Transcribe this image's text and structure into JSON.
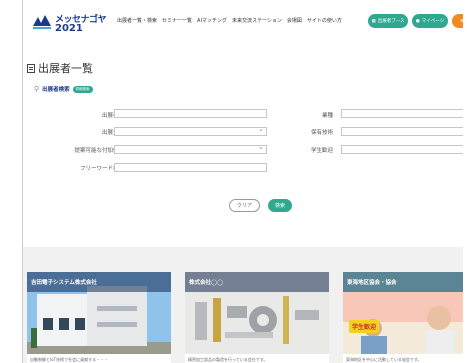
{
  "header": {
    "logo_name": "メッセナゴヤ",
    "logo_year": "2021",
    "nav": [
      "出展者一覧・検索",
      "セミナー一覧",
      "AIマッチング",
      "未来交流ステーション",
      "会場図",
      "サイトの使い方"
    ],
    "booth_button": "出展者ブース",
    "mypage_button": "マイページ"
  },
  "page": {
    "title": "出展者一覧"
  },
  "search": {
    "heading": "出展者検索",
    "badge": "詳細検索",
    "fields": {
      "exhibitor_name": "出展者名",
      "category": "出展分野",
      "proposal": "提案可能な付加価値",
      "freeword": "フリーワード検索",
      "industry": "業種",
      "technology": "保有技術",
      "student": "学生歓迎"
    },
    "clear_button": "クリア",
    "search_button": "検索"
  },
  "cards": [
    {
      "title": "吉田電子システム株式会社",
      "desc": "自動制御とIoT技術で社会に貢献する・・・"
    },
    {
      "title": "株式会社◯◯",
      "desc": "精密加工部品の製造を行っている会社です。"
    },
    {
      "title": "東海地区協会・協会",
      "badge": "学生歓迎",
      "desc": "東海地区を中心に活動している協会です。"
    }
  ],
  "colors": {
    "brand": "#1b3a8b",
    "accent": "#2fa88f",
    "orange": "#f08a22"
  }
}
